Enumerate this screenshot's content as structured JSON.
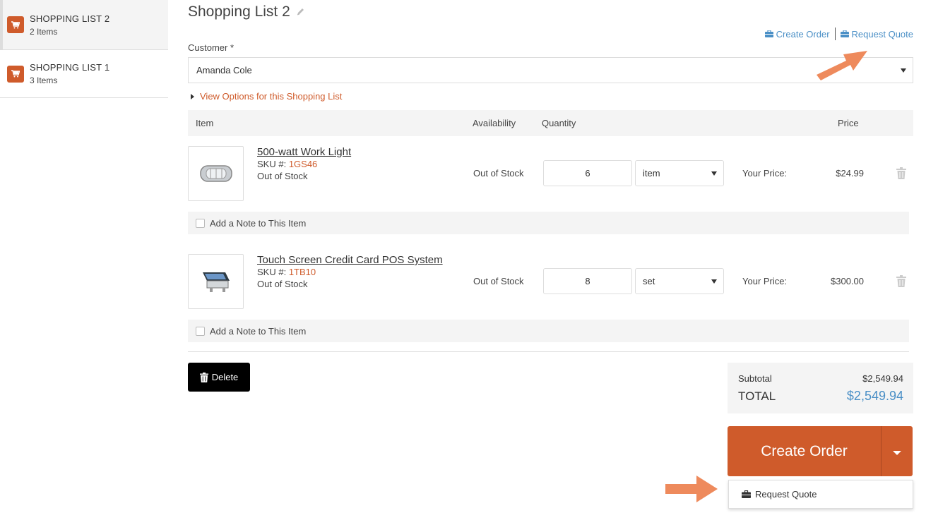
{
  "sidebar": {
    "lists": [
      {
        "title": "SHOPPING LIST 2",
        "count": "2 Items"
      },
      {
        "title": "SHOPPING LIST 1",
        "count": "3 Items"
      }
    ]
  },
  "header": {
    "title": "Shopping List 2",
    "create_order_link": "Create Order",
    "request_quote_link": "Request Quote"
  },
  "customer": {
    "label": "Customer",
    "required_mark": "*",
    "value": "Amanda Cole"
  },
  "view_options": "View Options for this Shopping List",
  "table": {
    "headers": {
      "item": "Item",
      "availability": "Availability",
      "quantity": "Quantity",
      "price": "Price"
    },
    "rows": [
      {
        "name": "500-watt Work Light",
        "sku_label": "SKU #:",
        "sku": "1GS46",
        "stock": "Out of Stock",
        "availability": "Out of Stock",
        "quantity": "6",
        "unit": "item",
        "your_price_label": "Your Price:",
        "price": "$24.99",
        "note": "Add a Note to This Item"
      },
      {
        "name": "Touch Screen Credit Card POS System",
        "sku_label": "SKU #:",
        "sku": "1TB10",
        "stock": "Out of Stock",
        "availability": "Out of Stock",
        "quantity": "8",
        "unit": "set",
        "your_price_label": "Your Price:",
        "price": "$300.00",
        "note": "Add a Note to This Item"
      }
    ]
  },
  "actions": {
    "delete": "Delete",
    "create_order": "Create Order",
    "request_quote": "Request Quote"
  },
  "totals": {
    "subtotal_label": "Subtotal",
    "subtotal": "$2,549.94",
    "total_label": "TOTAL",
    "total": "$2,549.94"
  },
  "colors": {
    "accent": "#cf5b2b",
    "link": "#4a8fc6",
    "annotation_arrow": "#ee8a5c"
  }
}
